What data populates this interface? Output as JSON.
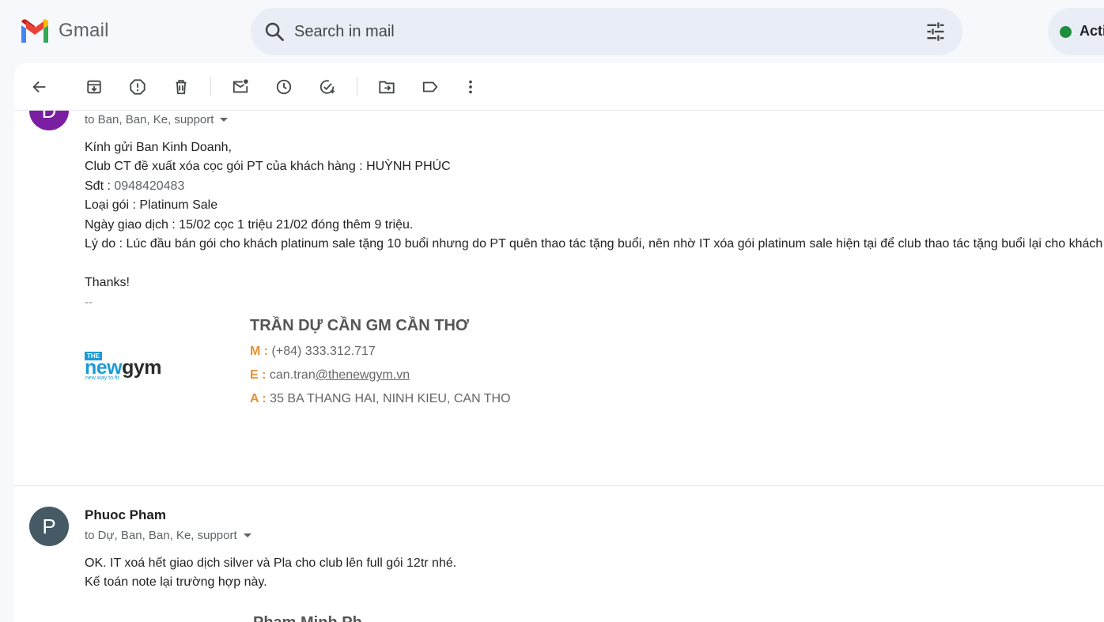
{
  "header": {
    "app_name": "Gmail",
    "search_placeholder": "Search in mail",
    "status_label": "Active",
    "status_color": "#1e8e3e"
  },
  "toolbar": {
    "buttons": [
      "back-icon",
      "archive-icon",
      "report-spam-icon",
      "delete-icon",
      "mark-unread-icon",
      "snooze-icon",
      "add-to-tasks-icon",
      "move-to-icon",
      "label-icon",
      "more-icon"
    ]
  },
  "messages": [
    {
      "avatar_letter": "D",
      "avatar_color": "#7b1fa2",
      "recipients": "to Ban, Ban, Ke, support",
      "body": [
        "Kính gửi Ban Kinh Doanh,",
        "Club CT đề xuất xóa cọc gói PT của khách hàng : HUỲNH PHÚC",
        "Loại gói : Platinum Sale",
        "Ngày giao dịch :  15/02 cọc 1 triệu  21/02 đóng thêm 9 triệu.",
        "Lý do : Lúc đầu bán gói cho khách platinum sale tặng 10 buổi nhưng do PT quên thao tác tặng buổi, nên nhờ IT xóa gói platinum sale hiện tại để club thao tác tặng buổi lại cho khách",
        "Thanks!"
      ],
      "phone_label": "Sđt : ",
      "phone_value": "0948420483",
      "sig_dashes": "--",
      "signature": {
        "name": "TRẦN DỰ CẦN GM CẦN THƠ",
        "m_label": "M :",
        "m_value": " (+84) 333.312.717",
        "e_label": "E  :",
        "e_user": " can.tran",
        "e_domain": "@thenewgym.vn",
        "a_label": "A  :",
        "a_value": " 35  BA THANG HAI, NINH KIEU, CAN THO",
        "logo_top": "THE",
        "logo_main_1": "new",
        "logo_main_2": "gym",
        "logo_tagline": "new way to fit"
      }
    },
    {
      "avatar_letter": "P",
      "avatar_color": "#455a64",
      "sender": "Phuoc Pham",
      "recipients": "to Dự, Ban, Ban, Ke, support",
      "body": [
        "OK. IT xoá hết giao dịch silver và Pla cho club lên full gói 12tr nhé.",
        "Kế toán note lại trường hợp này."
      ],
      "signature_name_partial": "Pham Minh Ph"
    }
  ]
}
